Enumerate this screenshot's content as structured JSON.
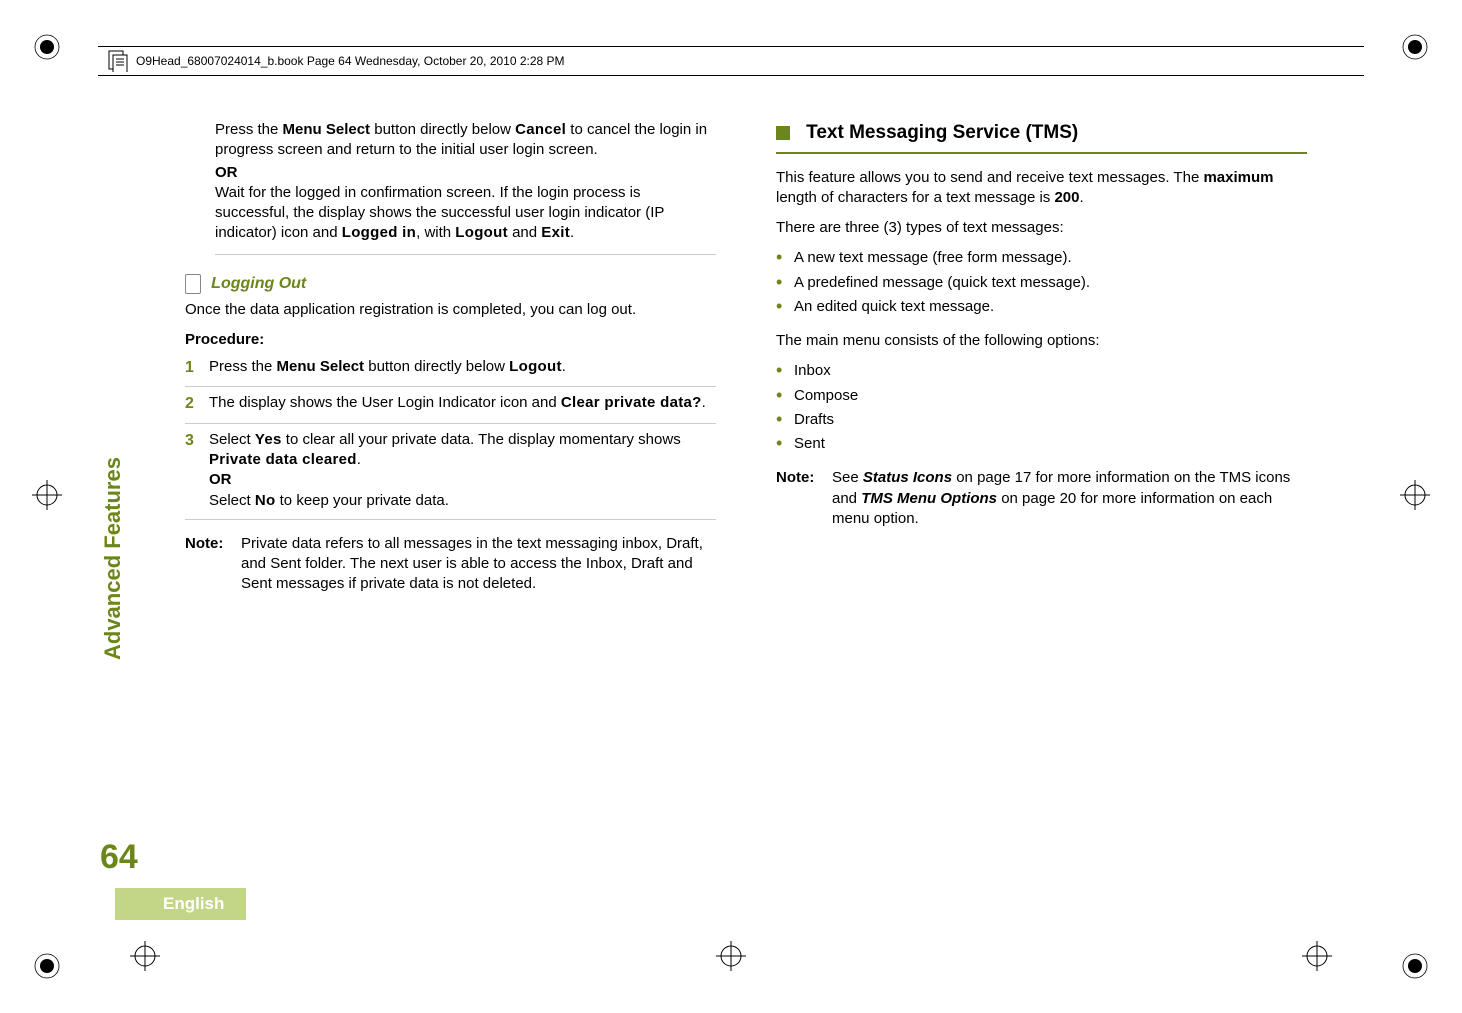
{
  "header": {
    "text": "O9Head_68007024014_b.book  Page 64  Wednesday, October 20, 2010  2:28 PM"
  },
  "left": {
    "p1_a": "Press the ",
    "p1_b": "Menu Select",
    "p1_c": " button directly below ",
    "p1_d": "Cancel",
    "p1_e": " to cancel the login in progress screen and return to the initial user login screen.",
    "or": "OR",
    "p2_a": "Wait for the logged in confirmation screen. If the login process is successful, the display shows the successful user login indicator (IP indicator) icon and ",
    "p2_b": "Logged in",
    "p2_c": ", with ",
    "p2_d": "Logout",
    "p2_e": " and ",
    "p2_f": "Exit",
    "p2_g": ".",
    "subheader": "Logging Out",
    "intro": "Once the data application registration is completed, you can log out.",
    "procedure": "Procedure:",
    "steps": {
      "s1_num": "1",
      "s1_a": "Press the ",
      "s1_b": "Menu Select",
      "s1_c": " button directly below ",
      "s1_d": "Logout",
      "s1_e": ".",
      "s2_num": "2",
      "s2_a": "The display shows the User Login Indicator icon and ",
      "s2_b": "Clear private data?",
      "s2_c": ".",
      "s3_num": "3",
      "s3_a": "Select ",
      "s3_b": "Yes",
      "s3_c": " to clear all your private data. The display momentary shows ",
      "s3_d": "Private data cleared",
      "s3_e": ".",
      "s3_or": "OR",
      "s3_f": "Select ",
      "s3_g": "No",
      "s3_h": " to keep your private data."
    },
    "note_label": "Note:",
    "note_body": "Private data refers to all messages in the text messaging inbox, Draft, and Sent folder. The next user is able to access the Inbox, Draft and Sent messages if private data is not deleted."
  },
  "right": {
    "title": "Text Messaging Service (TMS)",
    "p1_a": "This feature allows you to send and receive text messages. The ",
    "p1_b": "maximum",
    "p1_c": " length of characters for a text message is ",
    "p1_d": "200",
    "p1_e": ".",
    "p2": "There are three (3) types of text messages:",
    "types": {
      "t1": "A new text message (free form message).",
      "t2": "A predefined message (quick text message).",
      "t3": "An edited quick text message."
    },
    "p3": "The main menu consists of the following options:",
    "menu": {
      "m1": "Inbox",
      "m2": "Compose",
      "m3": "Drafts",
      "m4": "Sent"
    },
    "note_label": "Note:",
    "note_a": "See ",
    "note_b": "Status Icons",
    "note_c": " on page 17 for more information on the TMS icons and ",
    "note_d": "TMS Menu Options",
    "note_e": " on page 20 for more information on each menu option."
  },
  "sidebar": "Advanced Features",
  "page_number": "64",
  "english": "English"
}
